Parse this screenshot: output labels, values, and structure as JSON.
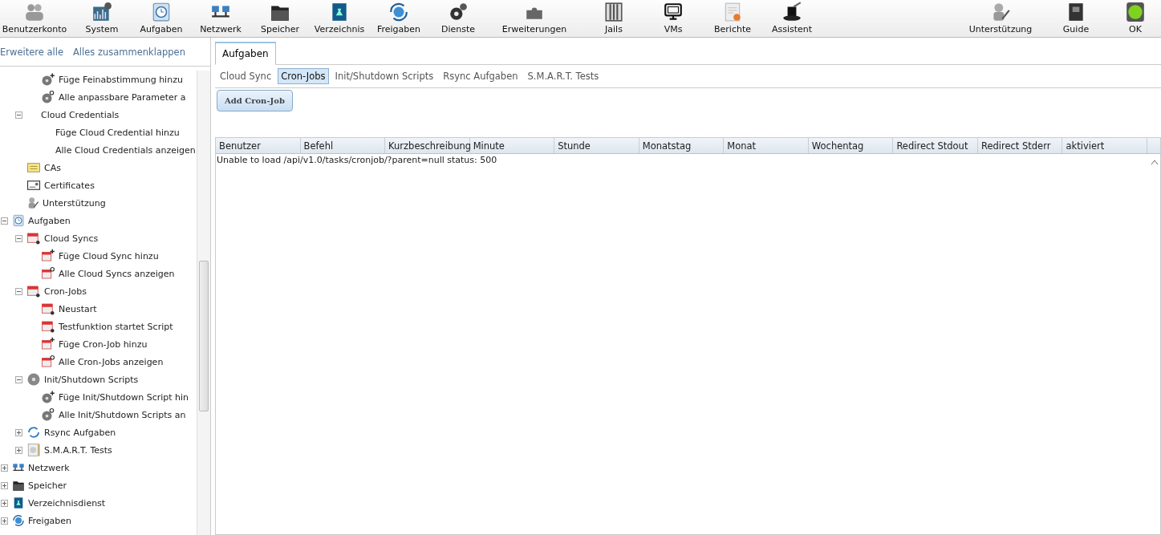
{
  "toolbar": {
    "left": [
      {
        "label": "Benutzerkonto",
        "kind": "users"
      },
      {
        "label": "System",
        "kind": "system"
      },
      {
        "label": "Aufgaben",
        "kind": "tasks"
      },
      {
        "label": "Netzwerk",
        "kind": "network"
      },
      {
        "label": "Speicher",
        "kind": "storage"
      },
      {
        "label": "Verzeichnis",
        "kind": "directory"
      },
      {
        "label": "Freigaben",
        "kind": "shares"
      },
      {
        "label": "Dienste",
        "kind": "services"
      },
      {
        "label": "Erweiterungen",
        "kind": "plugins"
      },
      {
        "label": "Jails",
        "kind": "jails"
      },
      {
        "label": "VMs",
        "kind": "vms"
      },
      {
        "label": "Berichte",
        "kind": "reports"
      },
      {
        "label": "Assistent",
        "kind": "wizard"
      }
    ],
    "right": [
      {
        "label": "Unterstützung",
        "kind": "support"
      },
      {
        "label": "Guide",
        "kind": "guide"
      },
      {
        "label": "OK",
        "kind": "status"
      }
    ]
  },
  "sidebar": {
    "links": [
      "Erweitere alle",
      "Alles zusammenklappen"
    ],
    "tree": [
      {
        "children": [
          {
            "children": [
              {
                "label": "Füge Feinabstimmung hinzu",
                "kind": "tune-add"
              },
              {
                "label": "Alle anpassbare Parameter a",
                "kind": "tune-search"
              }
            ]
          },
          {
            "label": "Cloud Credentials",
            "expanded": true,
            "children": [
              {
                "label": "Füge Cloud Credential hinzu"
              },
              {
                "label": "Alle Cloud Credentials anzeigen"
              }
            ]
          },
          {
            "label": "CAs",
            "kind": "ca"
          },
          {
            "label": "Certificates",
            "kind": "certificate"
          },
          {
            "label": "Unterstützung",
            "kind": "support"
          }
        ]
      },
      {
        "label": "Aufgaben",
        "kind": "tasks",
        "expanded": true,
        "children": [
          {
            "label": "Cloud Syncs",
            "kind": "calendar",
            "expanded": true,
            "children": [
              {
                "label": "Füge Cloud Sync hinzu",
                "kind": "calendar-add"
              },
              {
                "label": "Alle Cloud Syncs anzeigen",
                "kind": "calendar-search"
              }
            ]
          },
          {
            "label": "Cron-Jobs",
            "kind": "calendar",
            "expanded": true,
            "children": [
              {
                "label": "Neustart",
                "kind": "calendar"
              },
              {
                "label": "Testfunktion startet Script",
                "kind": "calendar"
              },
              {
                "label": "Füge Cron-Job hinzu",
                "kind": "calendar-add"
              },
              {
                "label": "Alle Cron-Jobs anzeigen",
                "kind": "calendar-search"
              }
            ]
          },
          {
            "label": "Init/Shutdown Scripts",
            "kind": "disc",
            "expanded": true,
            "children": [
              {
                "label": "Füge Init/Shutdown Script hin",
                "kind": "tune-add"
              },
              {
                "label": "Alle Init/Shutdown Scripts an",
                "kind": "tune-search"
              }
            ]
          },
          {
            "label": "Rsync Aufgaben",
            "kind": "rsync",
            "expanded": false
          },
          {
            "label": "S.M.A.R.T. Tests",
            "kind": "smart",
            "expanded": false
          }
        ]
      },
      {
        "label": "Netzwerk",
        "kind": "network",
        "expanded": false
      },
      {
        "label": "Speicher",
        "kind": "storage",
        "expanded": false
      },
      {
        "label": "Verzeichnisdienst",
        "kind": "directory",
        "expanded": false
      },
      {
        "label": "Freigaben",
        "kind": "shares",
        "expanded": false
      }
    ]
  },
  "tabs": [
    {
      "label": "Aufgaben",
      "selected": true
    }
  ],
  "subtabs": [
    {
      "label": "Cloud Sync",
      "selected": false
    },
    {
      "label": "Cron-Jobs",
      "selected": true
    },
    {
      "label": "Init/Shutdown Scripts",
      "selected": false
    },
    {
      "label": "Rsync Aufgaben",
      "selected": false
    },
    {
      "label": "S.M.A.R.T. Tests",
      "selected": false
    }
  ],
  "add_button": "Add Cron-Job",
  "table": {
    "columns": [
      "Benutzer",
      "Befehl",
      "Kurzbeschreibung",
      "Minute",
      "Stunde",
      "Monatstag",
      "Monat",
      "Wochentag",
      "Redirect Stdout",
      "Redirect Stderr",
      "aktiviert"
    ],
    "message": "Unable to load /api/v1.0/tasks/cronjob/?parent=null status: 500"
  }
}
